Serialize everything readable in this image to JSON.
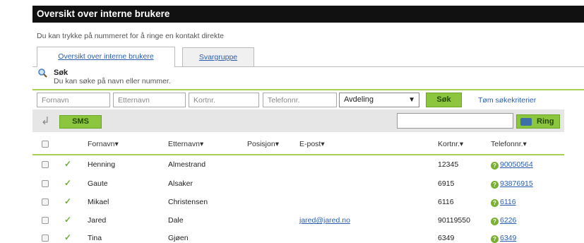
{
  "header": {
    "title": "Oversikt over interne brukere"
  },
  "hint": "Du kan trykke på nummeret for å ringe en kontakt direkte",
  "tabs": [
    {
      "label": "Oversikt over interne brukere",
      "active": true
    },
    {
      "label": "Svargruppe",
      "active": false
    }
  ],
  "search": {
    "title": "Søk",
    "description": "Du kan søke på navn eller nummer.",
    "firstname_placeholder": "Fornavn",
    "lastname_placeholder": "Etternavn",
    "shortnum_placeholder": "Kortnr.",
    "phone_placeholder": "Telefonnr.",
    "department_value": "Avdeling",
    "search_button": "Søk",
    "reset_link": "Tøm søkekriterier"
  },
  "toolbar": {
    "sms_label": "SMS",
    "ring_label": "Ring",
    "phone_value": ""
  },
  "table": {
    "columns": [
      "Fornavn▾",
      "Etternavn▾",
      "Posisjon▾",
      "E-post▾",
      "Kortnr.▾",
      "Telefonnr.▾"
    ],
    "rows": [
      {
        "first": "Henning",
        "last": "Almestrand",
        "position": "",
        "email": "",
        "short": "12345",
        "phone": "90050564"
      },
      {
        "first": "Gaute",
        "last": "Alsaker",
        "position": "",
        "email": "",
        "short": "6915",
        "phone": "93876915"
      },
      {
        "first": "Mikael",
        "last": "Christensen",
        "position": "",
        "email": "",
        "short": "6116",
        "phone": "6116"
      },
      {
        "first": "Jared",
        "last": "Dale",
        "position": "",
        "email": "jared@jared.no",
        "short": "90119550",
        "phone": "6226"
      },
      {
        "first": "Tina",
        "last": "Gjøen",
        "position": "",
        "email": "",
        "short": "6349",
        "phone": "6349"
      }
    ]
  },
  "colors": {
    "accent_green": "#8cc63f",
    "title_bar": "#111111",
    "link": "#2a5db0"
  },
  "icons": {
    "search": "magnifier-icon",
    "back": "back-arrow-icon",
    "phone": "phone-icon",
    "status": "check-icon",
    "info": "question-icon"
  }
}
